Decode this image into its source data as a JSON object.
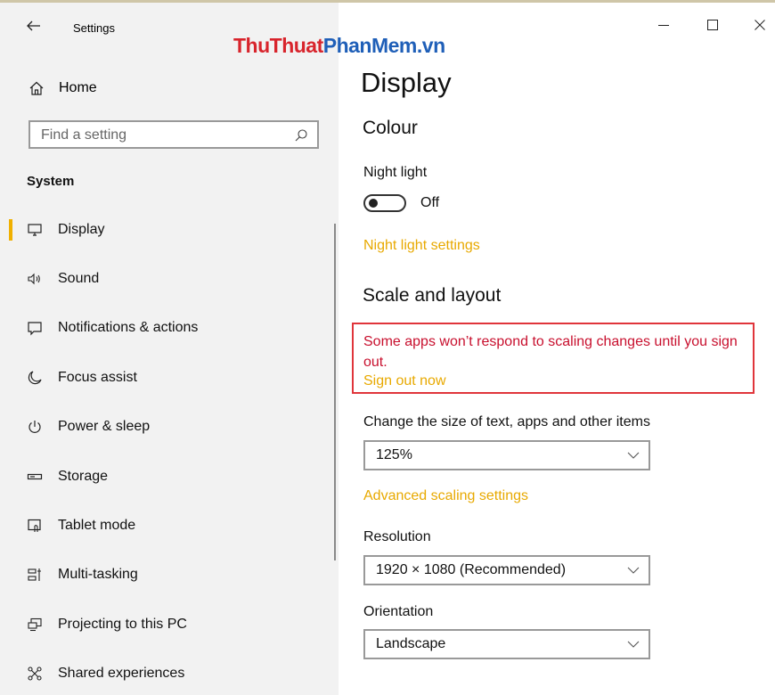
{
  "window": {
    "title": "Settings",
    "watermark": {
      "part1": "ThuThuat",
      "part2": "PhanMem.vn"
    }
  },
  "sidebar": {
    "home_label": "Home",
    "search": {
      "placeholder": "Find a setting"
    },
    "section": "System",
    "items": [
      {
        "label": "Display",
        "icon": "monitor-icon",
        "selected": true
      },
      {
        "label": "Sound",
        "icon": "speaker-icon"
      },
      {
        "label": "Notifications & actions",
        "icon": "notification-icon"
      },
      {
        "label": "Focus assist",
        "icon": "moon-icon"
      },
      {
        "label": "Power & sleep",
        "icon": "power-icon"
      },
      {
        "label": "Storage",
        "icon": "storage-icon"
      },
      {
        "label": "Tablet mode",
        "icon": "tablet-mode-icon"
      },
      {
        "label": "Multi-tasking",
        "icon": "multitasking-icon"
      },
      {
        "label": "Projecting to this PC",
        "icon": "projecting-icon"
      },
      {
        "label": "Shared experiences",
        "icon": "shared-experiences-icon"
      }
    ]
  },
  "main": {
    "title": "Display",
    "colour": {
      "heading": "Colour",
      "night_light_label": "Night light",
      "night_light_state": "Off",
      "night_light_settings_link": "Night light settings"
    },
    "scale": {
      "heading": "Scale and layout",
      "warning": "Some apps won’t respond to scaling changes until you sign out.",
      "sign_out_link": "Sign out now",
      "size_label": "Change the size of text, apps and other items",
      "size_value": "125%",
      "advanced_link": "Advanced scaling settings",
      "resolution_label": "Resolution",
      "resolution_value": "1920 × 1080 (Recommended)",
      "orientation_label": "Orientation",
      "orientation_value": "Landscape"
    }
  },
  "colors": {
    "accent_link": "#e8a900",
    "warning_text": "#c8102e",
    "highlight_border": "#e0353b",
    "selection_bar": "#f0b000",
    "sidebar_bg": "#f2f2f2"
  }
}
